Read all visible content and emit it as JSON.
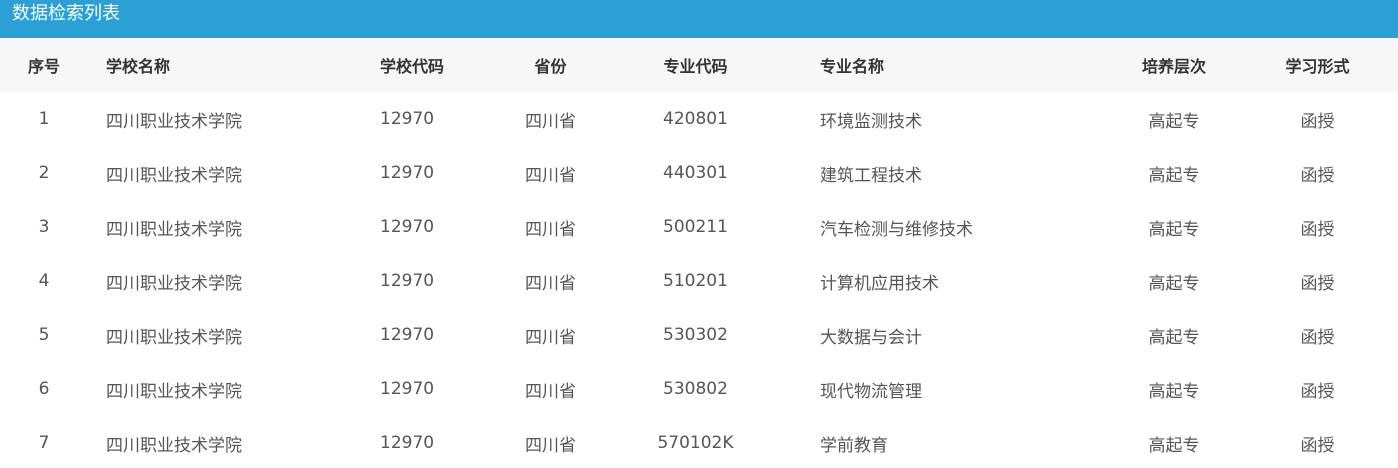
{
  "title": "数据检索列表",
  "colors": {
    "header_bar": "#2aa0d4",
    "header_text": "#ffffff",
    "thead_bg": "#f7f7f7",
    "thead_text": "#333333",
    "cell_text": "#555555"
  },
  "columns": [
    "序号",
    "学校名称",
    "学校代码",
    "省份",
    "专业代码",
    "专业名称",
    "培养层次",
    "学习形式"
  ],
  "rows": [
    {
      "index": "1",
      "school": "四川职业技术学院",
      "school_code": "12970",
      "province": "四川省",
      "major_code": "420801",
      "major_name": "环境监测技术",
      "level": "高起专",
      "mode": "函授"
    },
    {
      "index": "2",
      "school": "四川职业技术学院",
      "school_code": "12970",
      "province": "四川省",
      "major_code": "440301",
      "major_name": "建筑工程技术",
      "level": "高起专",
      "mode": "函授"
    },
    {
      "index": "3",
      "school": "四川职业技术学院",
      "school_code": "12970",
      "province": "四川省",
      "major_code": "500211",
      "major_name": "汽车检测与维修技术",
      "level": "高起专",
      "mode": "函授"
    },
    {
      "index": "4",
      "school": "四川职业技术学院",
      "school_code": "12970",
      "province": "四川省",
      "major_code": "510201",
      "major_name": "计算机应用技术",
      "level": "高起专",
      "mode": "函授"
    },
    {
      "index": "5",
      "school": "四川职业技术学院",
      "school_code": "12970",
      "province": "四川省",
      "major_code": "530302",
      "major_name": "大数据与会计",
      "level": "高起专",
      "mode": "函授"
    },
    {
      "index": "6",
      "school": "四川职业技术学院",
      "school_code": "12970",
      "province": "四川省",
      "major_code": "530802",
      "major_name": "现代物流管理",
      "level": "高起专",
      "mode": "函授"
    },
    {
      "index": "7",
      "school": "四川职业技术学院",
      "school_code": "12970",
      "province": "四川省",
      "major_code": "570102K",
      "major_name": "学前教育",
      "level": "高起专",
      "mode": "函授"
    }
  ]
}
